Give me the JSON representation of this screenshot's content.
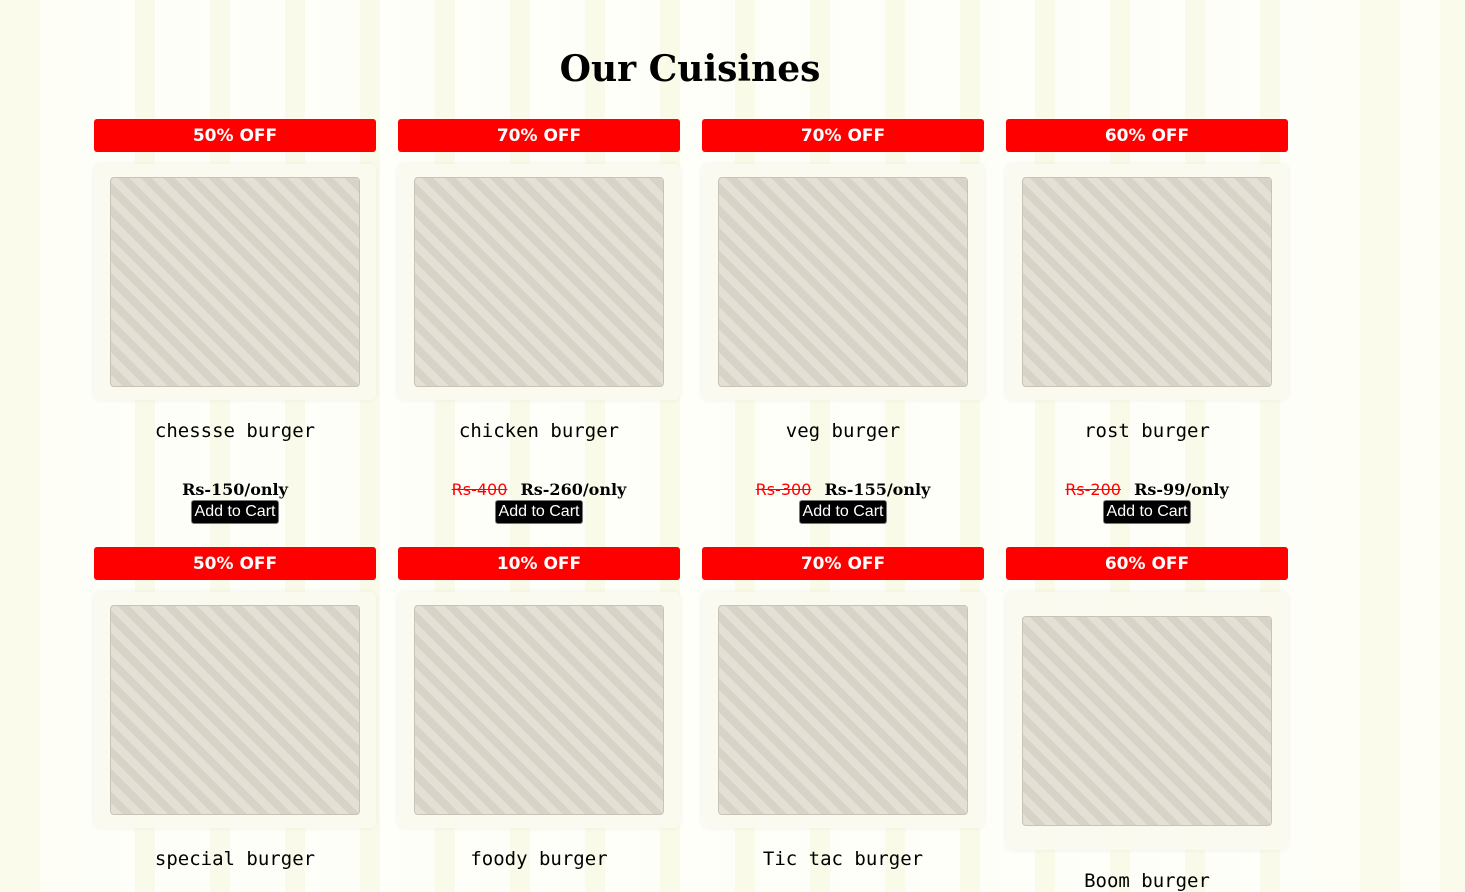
{
  "section": {
    "title": "Our Cuisines"
  },
  "cart_label": "Add to Cart",
  "colors": {
    "badge": "#ff0000",
    "old_price": "#ff0000",
    "cart_button": "#000000"
  },
  "items": [
    {
      "badge": "50% OFF",
      "name": "chessse burger",
      "old_price": "",
      "price": "Rs-150/only",
      "image": "burger-image"
    },
    {
      "badge": "70% OFF",
      "name": "chicken burger",
      "old_price": "Rs-400",
      "price": "Rs-260/only",
      "image": "burger-image"
    },
    {
      "badge": "70% OFF",
      "name": "veg burger",
      "old_price": "Rs-300",
      "price": "Rs-155/only",
      "image": "burger-image"
    },
    {
      "badge": "60% OFF",
      "name": "rost burger",
      "old_price": "Rs-200",
      "price": "Rs-99/only",
      "image": "burger-image"
    },
    {
      "badge": "50% OFF",
      "name": "special burger",
      "image": "burger-image"
    },
    {
      "badge": "10% OFF",
      "name": "foody burger",
      "image": "burger-image"
    },
    {
      "badge": "70% OFF",
      "name": "Tic tac burger",
      "image": "burger-image"
    },
    {
      "badge": "60% OFF",
      "name": "Boom burger",
      "image": "burger-image"
    }
  ]
}
